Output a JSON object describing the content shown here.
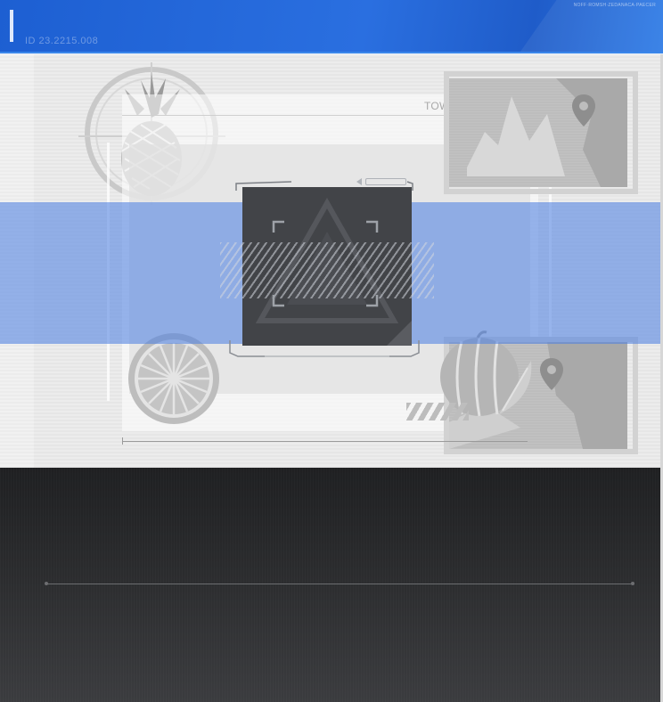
{
  "header": {
    "id_text": "ID 23.2215.008",
    "code_text": "NOFF·ROMSH·ZEDANACA·PAECER",
    "code_sub": ""
  },
  "panel": {
    "title": "TOWER OF FANTASY",
    "band_small_text": ""
  },
  "icons": {
    "pineapple": "pineapple-icon",
    "orange": "orange-slice-icon",
    "watermelon": "watermelon-icon",
    "map_pin": "map-pin-icon"
  },
  "colors": {
    "header_blue": "#1d5fd2",
    "band_blue": "#5082e1",
    "modal_dark": "#424448",
    "dark_bg": "#2b2c2e"
  }
}
